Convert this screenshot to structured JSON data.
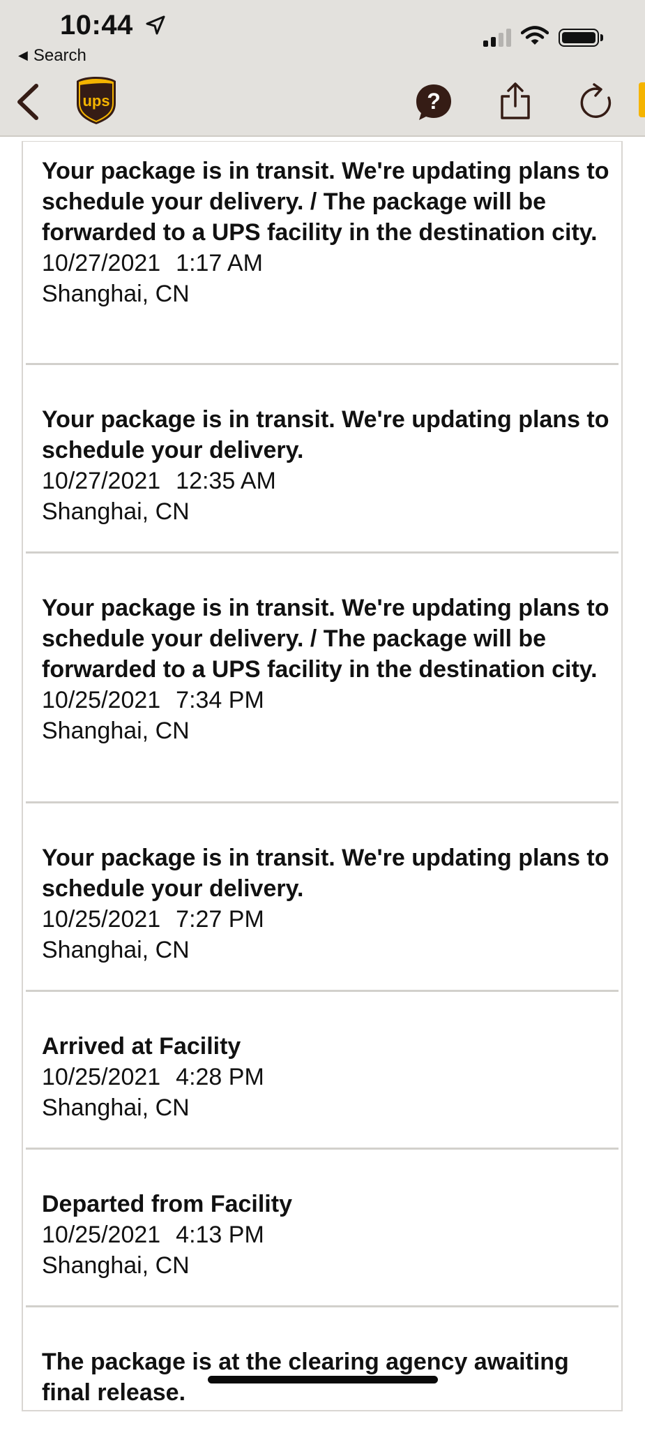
{
  "status_bar": {
    "time": "10:44",
    "back_label": "Search"
  },
  "header": {
    "logo_text": "ups",
    "help_glyph": "?"
  },
  "colors": {
    "ups_brown": "#351c15",
    "ups_gold": "#f5b400",
    "chrome_bg": "#e3e1dd"
  },
  "events": [
    {
      "title": "Your package is in transit. We're updating plans to schedule your delivery. / The package will be forwarded to a UPS facility in the destination city.",
      "date": "10/27/2021",
      "time": "1:17 AM",
      "location": "Shanghai, CN"
    },
    {
      "title": "Your package is in transit. We're updating plans to schedule your delivery.",
      "date": "10/27/2021",
      "time": "12:35 AM",
      "location": "Shanghai, CN"
    },
    {
      "title": "Your package is in transit. We're updating plans to schedule your delivery. / The package will be forwarded to a UPS facility in the destination city.",
      "date": "10/25/2021",
      "time": "7:34 PM",
      "location": "Shanghai, CN"
    },
    {
      "title": "Your package is in transit. We're updating plans to schedule your delivery.",
      "date": "10/25/2021",
      "time": "7:27 PM",
      "location": "Shanghai, CN"
    },
    {
      "title": "Arrived at Facility",
      "date": "10/25/2021",
      "time": "4:28 PM",
      "location": "Shanghai, CN"
    },
    {
      "title": "Departed from Facility",
      "date": "10/25/2021",
      "time": "4:13 PM",
      "location": "Shanghai, CN"
    },
    {
      "title": "The package is at the clearing agency awaiting final release.",
      "date": "",
      "time": "",
      "location": ""
    }
  ]
}
